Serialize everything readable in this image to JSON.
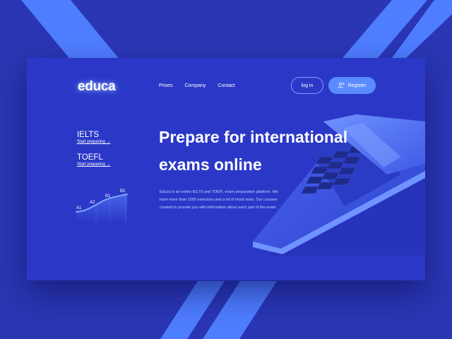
{
  "brand": {
    "logo": "educa",
    "colors": {
      "background": "#2a36b3",
      "card": "#2b38c7",
      "accent": "#5a8bff",
      "stripe": "#4f7dff"
    }
  },
  "nav": {
    "items": [
      {
        "label": "Prises"
      },
      {
        "label": "Company"
      },
      {
        "label": "Contact"
      }
    ]
  },
  "auth": {
    "login_label": "log in",
    "register_label": "Register",
    "register_icon": "user-plus-icon"
  },
  "exams": [
    {
      "title": "IELTS",
      "link": "Start preparing →"
    },
    {
      "title": "TOEFL",
      "link": "Start preparing →"
    }
  ],
  "levels": {
    "labels": [
      "A1",
      "A2",
      "B1",
      "B2"
    ]
  },
  "hero": {
    "headline_line1": "Prepare for international",
    "headline_line2": "exams online",
    "description": "Educa is an online IELTS and TOEFL exam preparation platform. We have more than 1000 exercises and a lot of mock tests. Our courses created to provide you with information about each part of the exam."
  },
  "illustration": {
    "icon": "laptop-keyboard-icon"
  }
}
